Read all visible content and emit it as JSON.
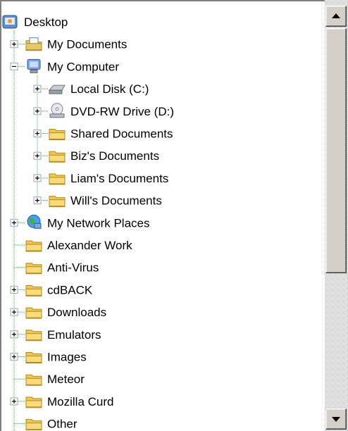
{
  "tree": {
    "nodes": [
      {
        "label": "Desktop",
        "icon": "desktop-icon",
        "depth": 0,
        "expander": "none"
      },
      {
        "label": "My Documents",
        "icon": "my-documents-icon",
        "depth": 1,
        "expander": "plus"
      },
      {
        "label": "My Computer",
        "icon": "my-computer-icon",
        "depth": 1,
        "expander": "minus"
      },
      {
        "label": "Local Disk (C:)",
        "icon": "hard-disk-icon",
        "depth": 2,
        "expander": "plus"
      },
      {
        "label": "DVD-RW Drive (D:)",
        "icon": "dvd-drive-icon",
        "depth": 2,
        "expander": "plus"
      },
      {
        "label": "Shared Documents",
        "icon": "folder-icon",
        "depth": 2,
        "expander": "plus"
      },
      {
        "label": "Biz's Documents",
        "icon": "folder-icon",
        "depth": 2,
        "expander": "plus"
      },
      {
        "label": "Liam's Documents",
        "icon": "folder-icon",
        "depth": 2,
        "expander": "plus"
      },
      {
        "label": "Will's Documents",
        "icon": "folder-icon",
        "depth": 2,
        "expander": "plus"
      },
      {
        "label": "My Network Places",
        "icon": "network-places-icon",
        "depth": 1,
        "expander": "plus"
      },
      {
        "label": "Alexander Work",
        "icon": "folder-icon",
        "depth": 1,
        "expander": "none"
      },
      {
        "label": "Anti-Virus",
        "icon": "folder-icon",
        "depth": 1,
        "expander": "none"
      },
      {
        "label": "cdBACK",
        "icon": "folder-icon",
        "depth": 1,
        "expander": "plus"
      },
      {
        "label": "Downloads",
        "icon": "folder-icon",
        "depth": 1,
        "expander": "plus"
      },
      {
        "label": "Emulators",
        "icon": "folder-icon",
        "depth": 1,
        "expander": "plus"
      },
      {
        "label": "Images",
        "icon": "folder-icon",
        "depth": 1,
        "expander": "plus"
      },
      {
        "label": "Meteor",
        "icon": "folder-icon",
        "depth": 1,
        "expander": "none"
      },
      {
        "label": "Mozilla Curd",
        "icon": "folder-icon",
        "depth": 1,
        "expander": "plus"
      },
      {
        "label": "Other",
        "icon": "folder-icon",
        "depth": 1,
        "expander": "none"
      }
    ]
  },
  "scrollbar": {
    "up_icon": "scroll-up-arrow-icon",
    "down_icon": "scroll-down-arrow-icon"
  },
  "colors": {
    "tree_line": "#20c020",
    "folder": "#f0c850",
    "scrollbar_face": "#d4d0c8"
  }
}
